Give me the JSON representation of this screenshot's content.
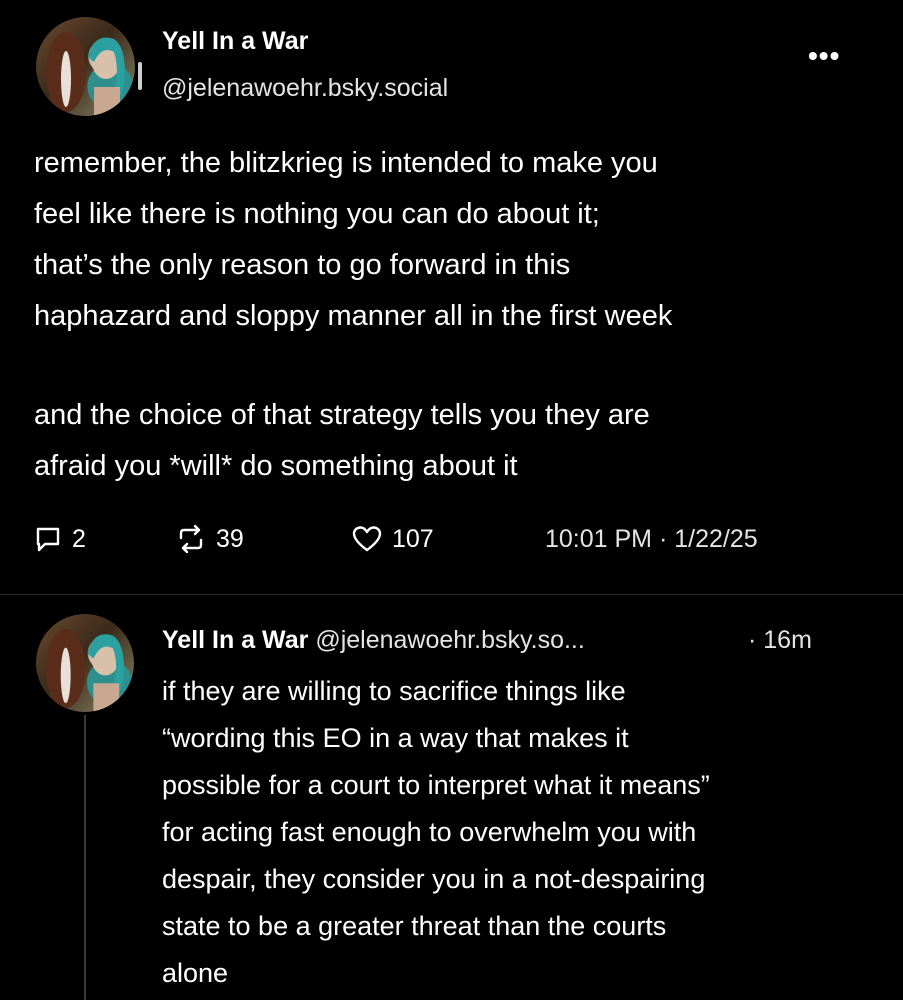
{
  "post": {
    "author_name": "Yell In a War",
    "author_handle": "@jelenawoehr.bsky.social",
    "more_label": "•••",
    "text_paragraph_1": "remember, the blitzkrieg is intended to make you\nfeel like there is nothing you can do about it;\nthat’s the only reason to go forward in this\nhaphazard and sloppy manner all in the first week",
    "text_paragraph_2": "and the choice of that strategy tells you they are\nafraid you *will* do something about it",
    "reply_count": "2",
    "repost_count": "39",
    "like_count": "107",
    "timestamp": "10:01 PM · 1/22/25",
    "icons": {
      "reply": "reply-icon",
      "repost": "repost-icon",
      "like": "heart-icon"
    }
  },
  "reply": {
    "author_name": "Yell In a War",
    "author_handle": "@jelenawoehr.bsky.so...",
    "time": "· 16m",
    "text": "if they are willing to sacrifice things like\n“wording this EO in a way that makes it\npossible for a court to interpret what it means”\nfor acting fast enough to overwhelm you with\ndespair, they consider you in a not-despairing\nstate to be a greater threat than the courts\nalone"
  },
  "colors": {
    "background": "#000000",
    "text": "#ffffff",
    "secondary_text": "#e4e4e4",
    "divider": "#2a2a2a"
  }
}
